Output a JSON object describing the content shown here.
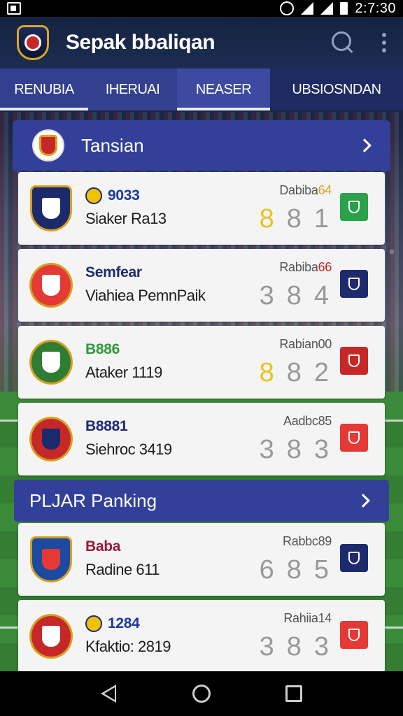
{
  "status_bar": {
    "time": "2:7:30"
  },
  "app_bar": {
    "title": "Sepak bbaliqan"
  },
  "tabs": [
    {
      "label": "RENUBIA"
    },
    {
      "label": "IHERUAI"
    },
    {
      "label": "NEASER"
    },
    {
      "label": "UBSIOSNDAN"
    }
  ],
  "sections": [
    {
      "title": "Tansian"
    },
    {
      "title": "PLJAR Panking"
    }
  ],
  "matches": [
    {
      "code": "9033",
      "code_color": "#1a3a9a",
      "name": "Siaker Ra13",
      "meta_prefix": "Dabiba",
      "meta_suffix": "64",
      "meta_suffix_color": "#e0a020",
      "scores": [
        "8",
        "8",
        "1"
      ],
      "score_styles": [
        "gold",
        "dark",
        "dark"
      ],
      "badge_color": "#2aa24a",
      "badge_icon": "pitch-icon",
      "crest_color": "#1b2a6a",
      "crest_inner": "#ffffff"
    },
    {
      "code": "Semfear",
      "code_color": "#1d2b6e",
      "name": "Viahiea PemnPaik",
      "meta_prefix": "Rabiba",
      "meta_suffix": "66",
      "meta_suffix_color": "#c62828",
      "scores": [
        "3",
        "8",
        "4"
      ],
      "score_styles": [
        "dark",
        "dark",
        "dark"
      ],
      "badge_color": "#1d2b6e",
      "badge_icon": "castle-icon",
      "crest_color": "#e53935",
      "crest_inner": "#ffffff"
    },
    {
      "code": "B886",
      "code_color": "#2e9a3a",
      "name": "Ataker 1119",
      "meta_prefix": "Rabian",
      "meta_suffix": "00",
      "meta_suffix_color": "#555555",
      "scores": [
        "8",
        "8",
        "2"
      ],
      "score_styles": [
        "gold",
        "dark",
        "dark"
      ],
      "badge_color": "#c62828",
      "badge_icon": "gear-crest-icon",
      "crest_color": "#2e7d32",
      "crest_inner": "#ffffff"
    },
    {
      "code": "B8881",
      "code_color": "#1d2b6e",
      "name": "Siehroc 3419",
      "meta_prefix": "Aadbc",
      "meta_suffix": "85",
      "meta_suffix_color": "#555555",
      "scores": [
        "3",
        "8",
        "3"
      ],
      "score_styles": [
        "dark",
        "dark",
        "dark"
      ],
      "badge_color": "#e53935",
      "badge_icon": "shield-icon",
      "crest_color": "#c62828",
      "crest_inner": "#1b2a6a"
    },
    {
      "code": "Baba",
      "code_color": "#9a1a3a",
      "name": "Radine 611",
      "meta_prefix": "Rabbc",
      "meta_suffix": "89",
      "meta_suffix_color": "#555555",
      "scores": [
        "6",
        "8",
        "5"
      ],
      "score_styles": [
        "dark",
        "dark",
        "dark"
      ],
      "badge_color": "#1d2b6e",
      "badge_icon": "star-shield-icon",
      "crest_color": "#1b4aa0",
      "crest_inner": "#e53935"
    },
    {
      "code": "1284",
      "code_color": "#1a3a9a",
      "name": "Kfaktio: 2819",
      "meta_prefix": "Rahiia",
      "meta_suffix": "14",
      "meta_suffix_color": "#555555",
      "scores": [
        "3",
        "8",
        "3"
      ],
      "score_styles": [
        "dark",
        "dark",
        "dark"
      ],
      "badge_color": "#e53935",
      "badge_icon": "shield-icon",
      "crest_color": "#c62828",
      "crest_inner": "#ffffff"
    }
  ]
}
